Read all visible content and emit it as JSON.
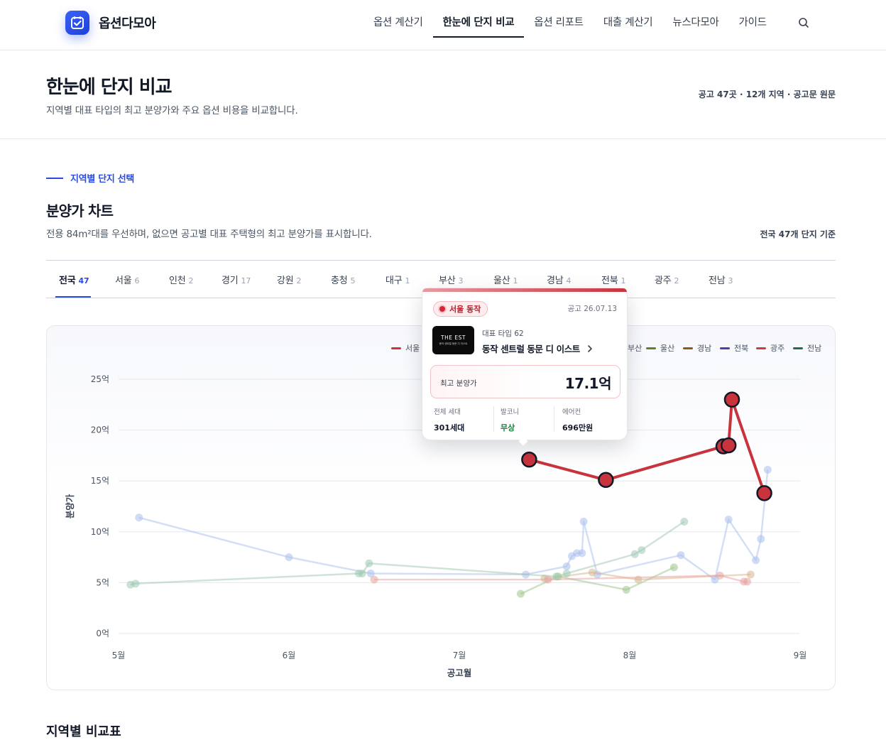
{
  "header": {
    "logo_text": "옵션다모아",
    "nav": [
      "옵션 계산기",
      "한눈에 단지 비교",
      "옵션 리포트",
      "대출 계산기",
      "뉴스다모아",
      "가이드"
    ],
    "active_nav": "한눈에 단지 비교"
  },
  "page": {
    "title": "한눈에 단지 비교",
    "subtitle": "지역별 대표 타입의 최고 분양가와 주요 옵션 비용을 비교합니다.",
    "meta": "공고 47곳 · 12개 지역 · 공고문 원문"
  },
  "section": {
    "eyebrow": "지역별 단지 선택",
    "title": "분양가 차트",
    "desc": "전용 84m²대를 우선하며, 없으면 공고별 대표 주택형의 최고 분양가를 표시합니다.",
    "meta": "전국 47개 단지 기준"
  },
  "tabs": [
    {
      "label": "전국",
      "count": "47",
      "active": true
    },
    {
      "label": "서울",
      "count": "6"
    },
    {
      "label": "인천",
      "count": "2"
    },
    {
      "label": "경기",
      "count": "17"
    },
    {
      "label": "강원",
      "count": "2"
    },
    {
      "label": "충청",
      "count": "5"
    },
    {
      "label": "대구",
      "count": "1"
    },
    {
      "label": "부산",
      "count": "3"
    },
    {
      "label": "울산",
      "count": "1"
    },
    {
      "label": "경남",
      "count": "4"
    },
    {
      "label": "전북",
      "count": "1"
    },
    {
      "label": "광주",
      "count": "2"
    },
    {
      "label": "전남",
      "count": "3"
    }
  ],
  "legend": [
    {
      "label": "서울",
      "color": "#d0323c"
    },
    {
      "label": "부산",
      "color": "#8fb0e8"
    },
    {
      "label": "울산",
      "color": "#5f7f2c"
    },
    {
      "label": "경남",
      "color": "#8a5a1e"
    },
    {
      "label": "전북",
      "color": "#5b3aa8"
    },
    {
      "label": "광주",
      "color": "#c2413a"
    },
    {
      "label": "전남",
      "color": "#1f6b4a"
    }
  ],
  "tooltip": {
    "region": "서울 동작",
    "date": "공고 26.07.13",
    "thumb_title": "THE EST",
    "thumb_sub": "동작 센트럴 동문 디 이스트",
    "type": "대표 타입 62",
    "name": "동작 센트럴 동문 디 이스트",
    "price_label": "최고 분양가",
    "price": "17.1억",
    "stats": [
      {
        "label": "전체 세대",
        "value": "301세대"
      },
      {
        "label": "발코니",
        "value": "무상",
        "color": "#15803d"
      },
      {
        "label": "에어컨",
        "value": "696만원"
      }
    ]
  },
  "next_section_title": "지역별 비교표",
  "chart_data": {
    "type": "scatter",
    "xlabel": "공고월",
    "ylabel": "분양가",
    "x_ticks": [
      "5월",
      "6월",
      "7월",
      "8월",
      "9월"
    ],
    "y_ticks": [
      "0억",
      "5억",
      "10억",
      "15억",
      "20억",
      "25억"
    ],
    "ylim": [
      0,
      25
    ],
    "x_unit": "month (5 = 5월 1일)",
    "grid": true,
    "legend_position": "top-right",
    "highlighted_series": "서울",
    "series": [
      {
        "name": "서울",
        "color": "#c9333c",
        "highlight": true,
        "points": [
          [
            7.41,
            17.1
          ],
          [
            7.86,
            15.1
          ],
          [
            8.55,
            18.4
          ],
          [
            8.58,
            18.5
          ],
          [
            8.6,
            23.0
          ],
          [
            8.79,
            13.8
          ]
        ]
      },
      {
        "name": "부산",
        "color": "#a9bfec",
        "points": [
          [
            5.12,
            11.4
          ],
          [
            6.0,
            7.5
          ],
          [
            6.48,
            5.9
          ],
          [
            7.39,
            5.8
          ],
          [
            7.63,
            6.6
          ],
          [
            7.66,
            7.6
          ],
          [
            7.69,
            7.9
          ],
          [
            7.72,
            7.9
          ],
          [
            7.73,
            11.0
          ],
          [
            7.81,
            5.8
          ],
          [
            8.3,
            7.7
          ],
          [
            8.5,
            5.3
          ],
          [
            8.58,
            11.2
          ],
          [
            8.74,
            7.2
          ],
          [
            8.77,
            9.3
          ],
          [
            8.81,
            16.1
          ]
        ]
      },
      {
        "name": "울산",
        "color": "#9cc48a",
        "points": [
          [
            7.36,
            3.9
          ],
          [
            7.58,
            5.6
          ],
          [
            7.98,
            4.3
          ],
          [
            8.26,
            6.5
          ]
        ]
      },
      {
        "name": "경남",
        "color": "#d6b48e",
        "points": [
          [
            7.5,
            5.4
          ],
          [
            7.78,
            6.0
          ],
          [
            8.05,
            5.3
          ],
          [
            8.71,
            5.8
          ]
        ]
      },
      {
        "name": "광주",
        "color": "#e8a2a0",
        "points": [
          [
            6.5,
            5.3
          ],
          [
            7.52,
            5.3
          ],
          [
            8.53,
            5.7
          ],
          [
            8.67,
            5.1
          ],
          [
            8.69,
            5.1
          ]
        ]
      },
      {
        "name": "전남",
        "color": "#9fc8b2",
        "points": [
          [
            5.07,
            4.8
          ],
          [
            5.1,
            4.9
          ],
          [
            6.47,
            6.9
          ],
          [
            6.41,
            5.9
          ],
          [
            6.43,
            5.9
          ],
          [
            7.63,
            5.9
          ],
          [
            7.57,
            5.6
          ],
          [
            8.07,
            8.2
          ],
          [
            8.03,
            7.8
          ],
          [
            8.32,
            11.0
          ]
        ]
      }
    ]
  }
}
